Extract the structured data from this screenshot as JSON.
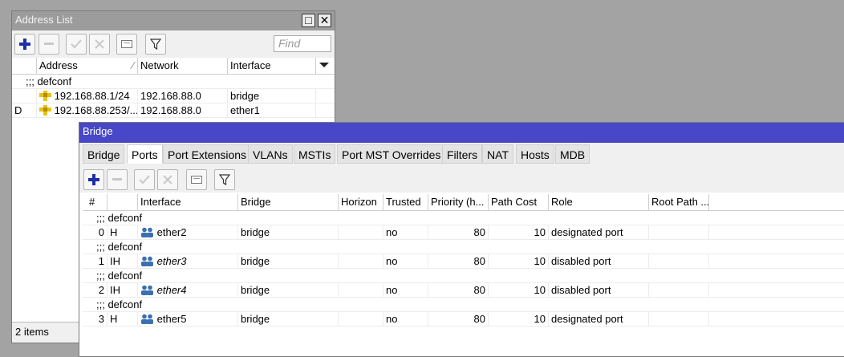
{
  "address_list": {
    "title": "Address List",
    "find_placeholder": "Find",
    "columns": [
      "Address",
      "Network",
      "Interface"
    ],
    "comment": ";;; defconf",
    "rows": [
      {
        "flag": "",
        "address": "192.168.88.1/24",
        "network": "192.168.88.0",
        "interface": "bridge"
      },
      {
        "flag": "D",
        "address": "192.168.88.253/...",
        "network": "192.168.88.0",
        "interface": "ether1"
      }
    ],
    "status": "2 items"
  },
  "bridge": {
    "title": "Bridge",
    "tabs": [
      "Bridge",
      "Ports",
      "Port Extensions",
      "VLANs",
      "MSTIs",
      "Port MST Overrides",
      "Filters",
      "NAT",
      "Hosts",
      "MDB"
    ],
    "columns": [
      "#",
      "",
      "Interface",
      "Bridge",
      "Horizon",
      "Trusted",
      "Priority (h...",
      "Path Cost",
      "Role",
      "Root Path ..."
    ],
    "rows": [
      {
        "comment": ";;; defconf",
        "num": "0",
        "flag": "H",
        "interface": "ether2",
        "bridge": "bridge",
        "horizon": "",
        "trusted": "no",
        "priority": "80",
        "path_cost": "10",
        "role": "designated port",
        "root_path": ""
      },
      {
        "comment": ";;; defconf",
        "num": "1",
        "flag": "IH",
        "interface": "ether3",
        "bridge": "bridge",
        "horizon": "",
        "trusted": "no",
        "priority": "80",
        "path_cost": "10",
        "role": "disabled port",
        "root_path": ""
      },
      {
        "comment": ";;; defconf",
        "num": "2",
        "flag": "IH",
        "interface": "ether4",
        "bridge": "bridge",
        "horizon": "",
        "trusted": "no",
        "priority": "80",
        "path_cost": "10",
        "role": "disabled port",
        "root_path": ""
      },
      {
        "comment": ";;; defconf",
        "num": "3",
        "flag": "H",
        "interface": "ether5",
        "bridge": "bridge",
        "horizon": "",
        "trusted": "no",
        "priority": "80",
        "path_cost": "10",
        "role": "designated port",
        "root_path": ""
      }
    ]
  },
  "icons": {
    "add": "plus-icon",
    "remove": "minus-icon",
    "enable": "check-icon",
    "disable": "x-icon",
    "comment": "note-icon",
    "filter": "filter-icon",
    "address": "address-tag-icon",
    "port": "interface-users-icon"
  },
  "colors": {
    "active_title": "#4747c7",
    "inactive_title": "#9c9c9c",
    "desktop": "#a3a3a3"
  }
}
